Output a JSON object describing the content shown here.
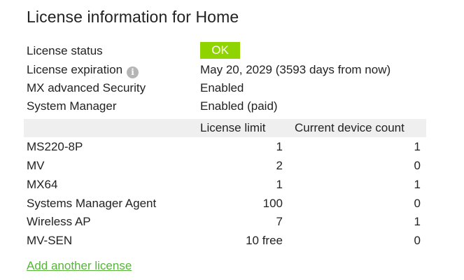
{
  "title": "License information for Home",
  "info": {
    "status": {
      "label": "License status",
      "value": "OK",
      "color": "#8fd400"
    },
    "expiration": {
      "label": "License expiration",
      "icon": "info-icon",
      "value": "May 20, 2029 (3593 days from now)"
    },
    "security": {
      "label": "MX advanced Security",
      "value": "Enabled"
    },
    "systems_manager": {
      "label": "System Manager",
      "value": "Enabled (paid)"
    }
  },
  "table": {
    "columns": [
      "License limit",
      "Current device count"
    ],
    "rows": [
      {
        "name": "MS220-8P",
        "limit": "1",
        "count": "1"
      },
      {
        "name": "MV",
        "limit": "2",
        "count": "0"
      },
      {
        "name": "MX64",
        "limit": "1",
        "count": "1"
      },
      {
        "name": "Systems Manager Agent",
        "limit": "100",
        "count": "0"
      },
      {
        "name": "Wireless AP",
        "limit": "7",
        "count": "1"
      },
      {
        "name": "MV-SEN",
        "limit": "10 free",
        "count": "0"
      }
    ]
  },
  "add_link": {
    "label": "Add another license",
    "color": "#56b53a"
  }
}
